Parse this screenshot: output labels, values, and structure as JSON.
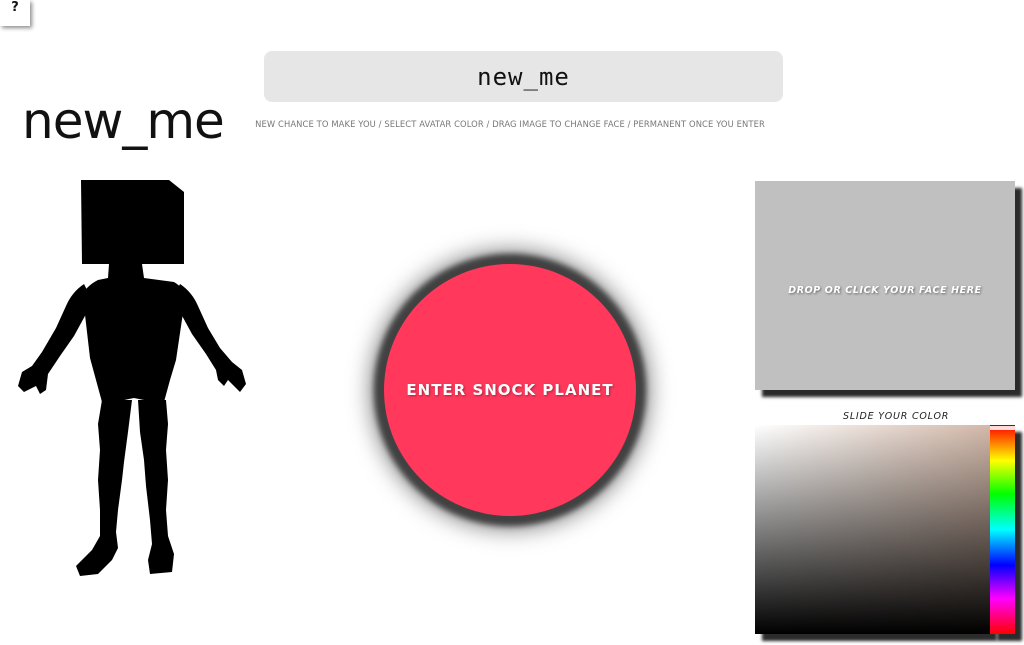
{
  "help": {
    "label": "?"
  },
  "name_field": {
    "value": "new_me"
  },
  "instructions": "NEW CHANCE TO MAKE YOU / SELECT AVATAR COLOR / DRAG IMAGE TO CHANGE FACE / PERMANENT ONCE YOU ENTER",
  "avatar": {
    "name": "new_me",
    "color": "#000000"
  },
  "enter_button": {
    "label": "ENTER SNOCK PLANET",
    "color": "#ff385c"
  },
  "face_drop": {
    "label": "DROP OR CLICK YOUR FACE HERE",
    "color": "#c0c0c0"
  },
  "color_picker": {
    "label": "SLIDE YOUR COLOR",
    "base_hue_color": "#d3b9aa",
    "hue_position": 0
  }
}
